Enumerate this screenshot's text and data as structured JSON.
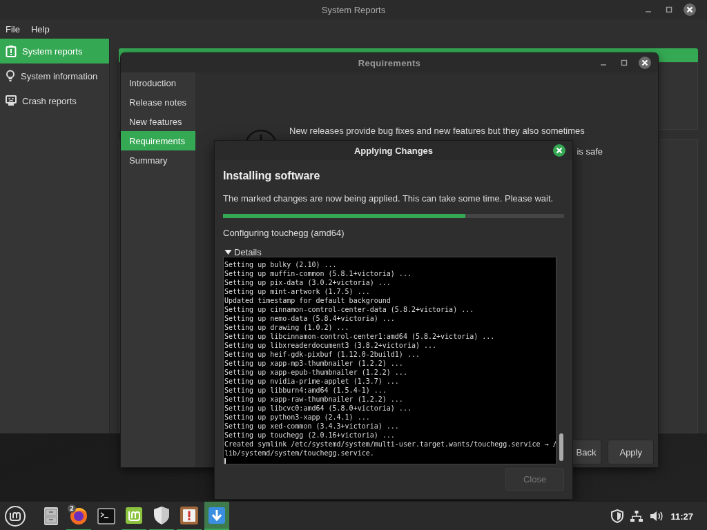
{
  "main_window": {
    "title": "System Reports",
    "menu": [
      "File",
      "Help"
    ],
    "sidebar": [
      {
        "label": "System reports",
        "selected": true
      },
      {
        "label": "System information",
        "selected": false
      },
      {
        "label": "Crash reports",
        "selected": false
      }
    ]
  },
  "requirements_window": {
    "title": "Requirements",
    "steps": [
      {
        "label": "Introduction",
        "selected": false
      },
      {
        "label": "Release notes",
        "selected": false
      },
      {
        "label": "New features",
        "selected": false
      },
      {
        "label": "Requirements",
        "selected": true
      },
      {
        "label": "Summary",
        "selected": false
      }
    ],
    "message_line": "New releases provide bug fixes and new features but they also sometimes",
    "message_fragment": "is safe",
    "buttons": [
      "Back",
      "Apply"
    ]
  },
  "dialog": {
    "title": "Applying Changes",
    "heading": "Installing software",
    "message": "The marked changes are now being applied. This can take some time. Please wait.",
    "progress": {
      "level": 0.71
    },
    "status": "Configuring touchegg (amd64)",
    "details": {
      "label": "Details",
      "expanded": true
    },
    "log": [
      "Setting up bulky (2.10) ...",
      "Setting up muffin-common (5.8.1+victoria) ...",
      "Setting up pix-data (3.0.2+victoria) ...",
      "Setting up mint-artwork (1.7.5) ...",
      "Updated timestamp for default background",
      "Setting up cinnamon-control-center-data (5.8.2+victoria) ...",
      "Setting up nemo-data (5.8.4+victoria) ...",
      "Setting up drawing (1.0.2) ...",
      "Setting up libcinnamon-control-center1:amd64 (5.8.2+victoria) ...",
      "Setting up libxreaderdocument3 (3.8.2+victoria) ...",
      "Setting up heif-gdk-pixbuf (1.12.0-2build1) ...",
      "Setting up xapp-mp3-thumbnailer (1.2.2) ...",
      "Setting up xapp-epub-thumbnailer (1.2.2) ...",
      "Setting up nvidia-prime-applet (1.3.7) ...",
      "Setting up libburn4:amd64 (1.5.4-1) ...",
      "Setting up xapp-raw-thumbnailer (1.2.2) ...",
      "Setting up libcvc0:amd64 (5.8.0+victoria) ...",
      "Setting up python3-xapp (2.4.1) ...",
      "Setting up xed-common (3.4.3+victoria) ...",
      "Setting up touchegg (2.0.16+victoria) ...",
      "Created symlink /etc/systemd/system/multi-user.target.wants/touchegg.service → /",
      "lib/systemd/system/touchegg.service."
    ],
    "close_button": {
      "label": "Close",
      "disabled": true
    }
  },
  "taskbar": {
    "launchers": [
      {
        "kind": "files",
        "running": false,
        "focused": false
      },
      {
        "kind": "browser",
        "badge": "2",
        "running": true,
        "focused": false
      },
      {
        "kind": "terminal",
        "running": false,
        "focused": false
      },
      {
        "kind": "software",
        "running": true,
        "focused": false
      },
      {
        "kind": "shield",
        "running": true,
        "focused": false
      },
      {
        "kind": "report",
        "running": true,
        "focused": false
      },
      {
        "kind": "update",
        "running": true,
        "focused": true
      }
    ],
    "clock": "11:27"
  }
}
